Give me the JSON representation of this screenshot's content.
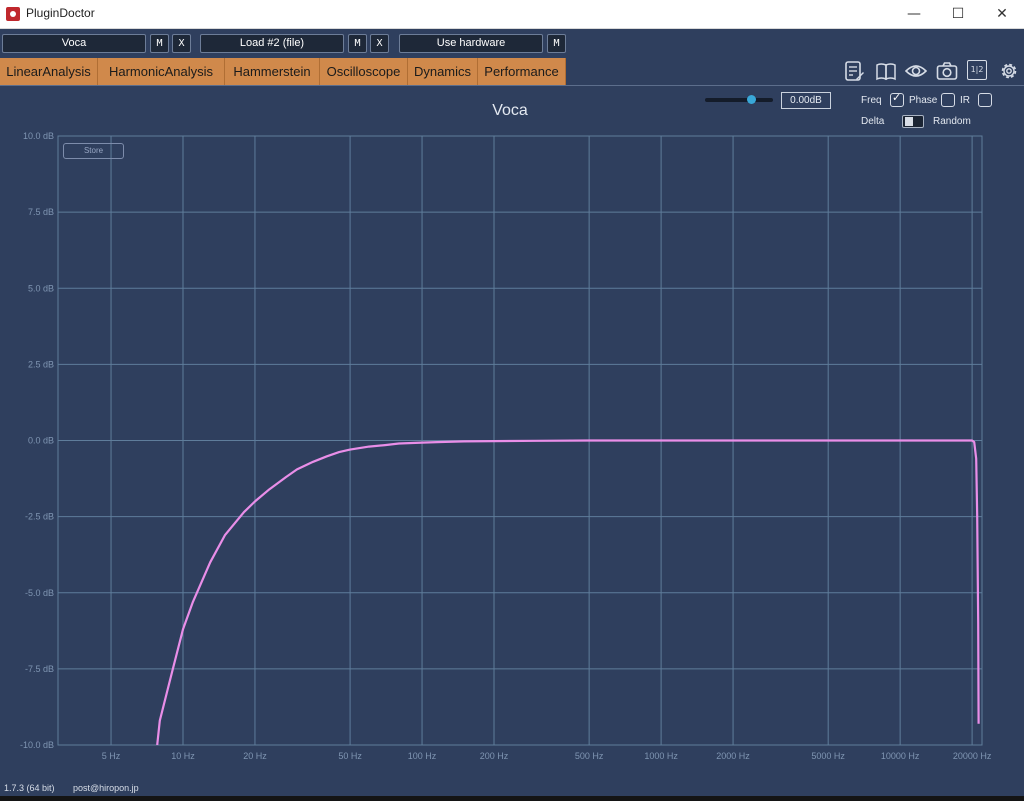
{
  "window": {
    "title": "PluginDoctor",
    "minimize": "—",
    "maximize": "☐",
    "close": "✕"
  },
  "slots": [
    {
      "name": "Voca",
      "buttons": [
        "M",
        "X"
      ]
    },
    {
      "name": "Load #2 (file)",
      "buttons": [
        "M",
        "X"
      ]
    },
    {
      "name": "Use hardware",
      "buttons": [
        "M"
      ]
    }
  ],
  "tabs": [
    "LinearAnalysis",
    "HarmonicAnalysis",
    "Hammerstein",
    "Oscilloscope",
    "Dynamics",
    "Performance"
  ],
  "toolbar_icons": [
    "notes-icon",
    "book-icon",
    "eye-icon",
    "camera-icon",
    "compare-icon",
    "gear-icon"
  ],
  "compare_label": "1|2",
  "chart_title": "Voca",
  "gain_value": "0.00dB",
  "gain_level": 0.68,
  "options": {
    "freq": "Freq",
    "phase": "Phase",
    "ir": "IR",
    "delta": "Delta",
    "random": "Random",
    "freq_checked": true,
    "phase_checked": false,
    "ir_checked": false
  },
  "store_label": "Store",
  "chart_data": {
    "type": "line",
    "title": "Voca",
    "x_scale": "log",
    "xlim": [
      3,
      22000
    ],
    "ylim": [
      -10,
      10
    ],
    "y_ticks": [
      10,
      7.5,
      5,
      2.5,
      0,
      -2.5,
      -5,
      -7.5,
      -10
    ],
    "y_tick_labels": [
      "10.0 dB",
      "7.5 dB",
      "5.0 dB",
      "2.5 dB",
      "0.0 dB",
      "-2.5 dB",
      "-5.0 dB",
      "-7.5 dB",
      "-10.0 dB"
    ],
    "x_ticks": [
      5,
      10,
      20,
      50,
      100,
      200,
      500,
      1000,
      2000,
      5000,
      10000,
      20000
    ],
    "x_tick_labels": [
      "5 Hz",
      "10 Hz",
      "20 Hz",
      "50 Hz",
      "100 Hz",
      "200 Hz",
      "500 Hz",
      "1000 Hz",
      "2000 Hz",
      "5000 Hz",
      "10000 Hz",
      "20000 Hz"
    ],
    "grid": true,
    "series_color": "#e98ee8",
    "x": [
      7.8,
      8,
      9,
      10,
      11,
      13,
      15,
      18,
      20,
      23,
      27,
      30,
      35,
      40,
      45,
      50,
      60,
      70,
      80,
      100,
      120,
      150,
      200,
      300,
      500,
      1000,
      2000,
      5000,
      10000,
      15000,
      19000,
      20000,
      20400,
      20800,
      21000,
      21200,
      21300
    ],
    "y": [
      -10,
      -9.2,
      -7.6,
      -6.2,
      -5.3,
      -4.0,
      -3.1,
      -2.35,
      -2.0,
      -1.6,
      -1.2,
      -0.95,
      -0.7,
      -0.52,
      -0.38,
      -0.3,
      -0.2,
      -0.15,
      -0.1,
      -0.07,
      -0.05,
      -0.03,
      -0.02,
      -0.01,
      0,
      0,
      0,
      0,
      0,
      0,
      0,
      0,
      -0.05,
      -0.6,
      -2.5,
      -6.0,
      -9.3
    ]
  },
  "footer": {
    "version": "1.7.3 (64 bit)",
    "email": "post@hiropon.jp"
  }
}
